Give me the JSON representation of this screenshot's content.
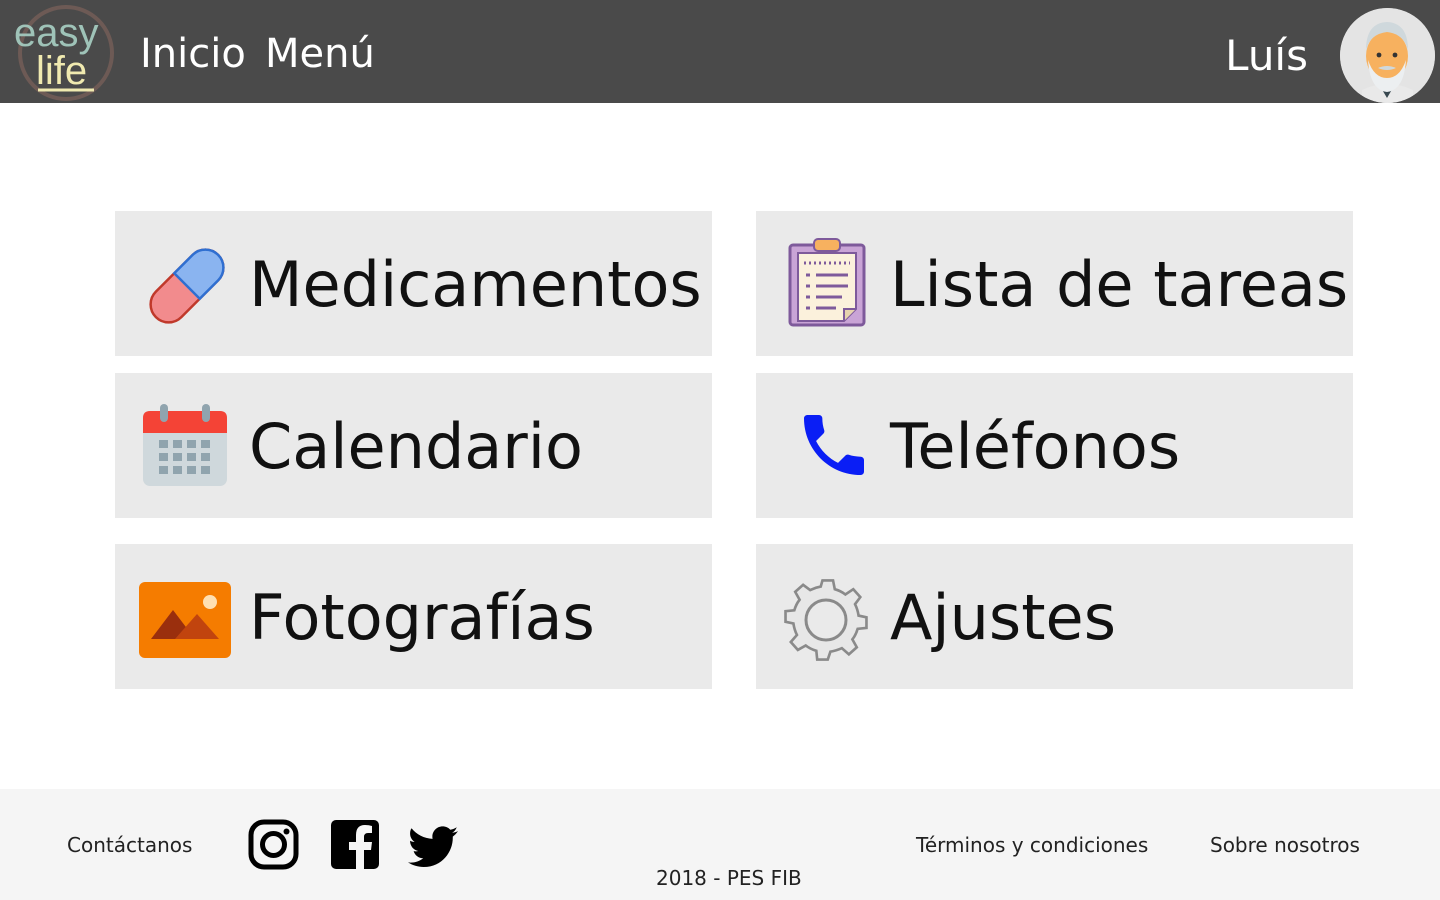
{
  "header": {
    "logo": {
      "line1": "easy",
      "line2": "life",
      "icon": "easy-life-logo"
    },
    "nav": [
      {
        "label": "Inicio"
      },
      {
        "label": "Menú"
      }
    ],
    "user": {
      "name": "Luís",
      "avatar_icon": "elderly-man-avatar"
    }
  },
  "tiles": [
    {
      "label": "Medicamentos",
      "icon": "pill-icon"
    },
    {
      "label": "Lista de tareas",
      "icon": "clipboard-icon"
    },
    {
      "label": "Calendario",
      "icon": "calendar-icon"
    },
    {
      "label": "Teléfonos",
      "icon": "phone-icon"
    },
    {
      "label": "Fotografías",
      "icon": "image-icon"
    },
    {
      "label": "Ajustes",
      "icon": "gear-icon"
    }
  ],
  "footer": {
    "contact": "Contáctanos",
    "terms": "Términos y condiciones",
    "about": "Sobre nosotros",
    "copyright": "2018 - PES FIB",
    "social": [
      "instagram-icon",
      "facebook-icon",
      "twitter-icon"
    ]
  },
  "colors": {
    "header_bg": "#4a4a4a",
    "tile_bg": "#eaeaea",
    "footer_bg": "#f5f5f5",
    "phone_blue": "#0a1ef5",
    "photo_orange": "#f57c00"
  }
}
